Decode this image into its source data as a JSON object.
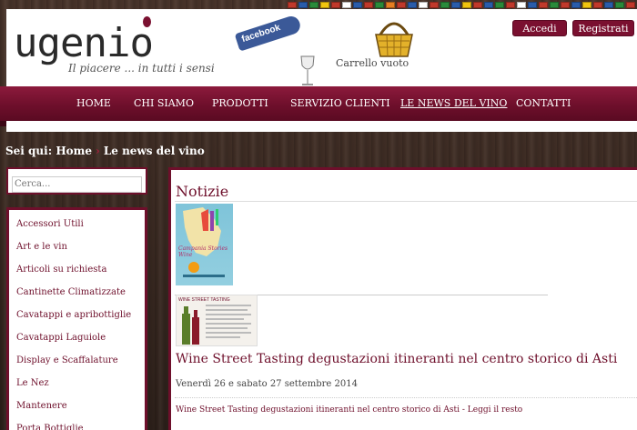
{
  "flags": [
    "#c0392b",
    "#2a5caa",
    "#2a8a3a",
    "#f1c40f",
    "#c0392b",
    "#ffffff",
    "#2a5caa",
    "#c0392b",
    "#2a8a3a",
    "#e67e22",
    "#c0392b",
    "#2a5caa",
    "#ffffff",
    "#c0392b",
    "#2a8a3a",
    "#2a5caa",
    "#f1c40f",
    "#c0392b",
    "#2a5caa",
    "#2a8a3a",
    "#c0392b",
    "#ffffff",
    "#2a5caa",
    "#c0392b",
    "#2a8a3a",
    "#c0392b",
    "#2a5caa",
    "#f1c40f",
    "#c0392b",
    "#2a5caa",
    "#2a8a3a",
    "#c0392b"
  ],
  "header": {
    "logo": "ugenio",
    "tagline": "Il piacere ... in tutti i sensi",
    "facebook_label": "facebook",
    "cart_text": "Carrello vuoto",
    "login_label": "Accedi",
    "register_label": "Registrati"
  },
  "nav": {
    "items": [
      "HOME",
      "CHI SIAMO",
      "PRODOTTI",
      "SERVIZIO CLIENTI",
      "LE NEWS DEL VINO",
      "CONTATTI"
    ],
    "active_index": 4
  },
  "breadcrumb": {
    "prefix": "Sei qui:",
    "home": "Home",
    "current": "Le news del vino"
  },
  "search": {
    "placeholder": "Cerca..."
  },
  "sidebar": {
    "items": [
      "Accessori Utili",
      "Art e le vin",
      "Articoli su richiesta",
      "Cantinette Climatizzate",
      "Cavatappi e apribottiglie",
      "Cavatappi Laguiole",
      "Display e Scaffalature",
      "Le Nez",
      "Mantenere",
      "Porta Bottiglie"
    ]
  },
  "main": {
    "title": "Notizie",
    "poster1_text": "Campania Stories Wine",
    "poster2_text": "WINE STREET TASTING",
    "article_title": "Wine Street Tasting degustazioni itineranti nel centro storico di Asti",
    "article_date": "Venerdì 26 e sabato 27 settembre 2014",
    "article_summary": "Wine Street Tasting degustazioni itineranti nel centro storico di Asti - Leggi il resto"
  },
  "colors": {
    "brand": "#6e0f2b",
    "nav_top": "#8c1a3c"
  }
}
